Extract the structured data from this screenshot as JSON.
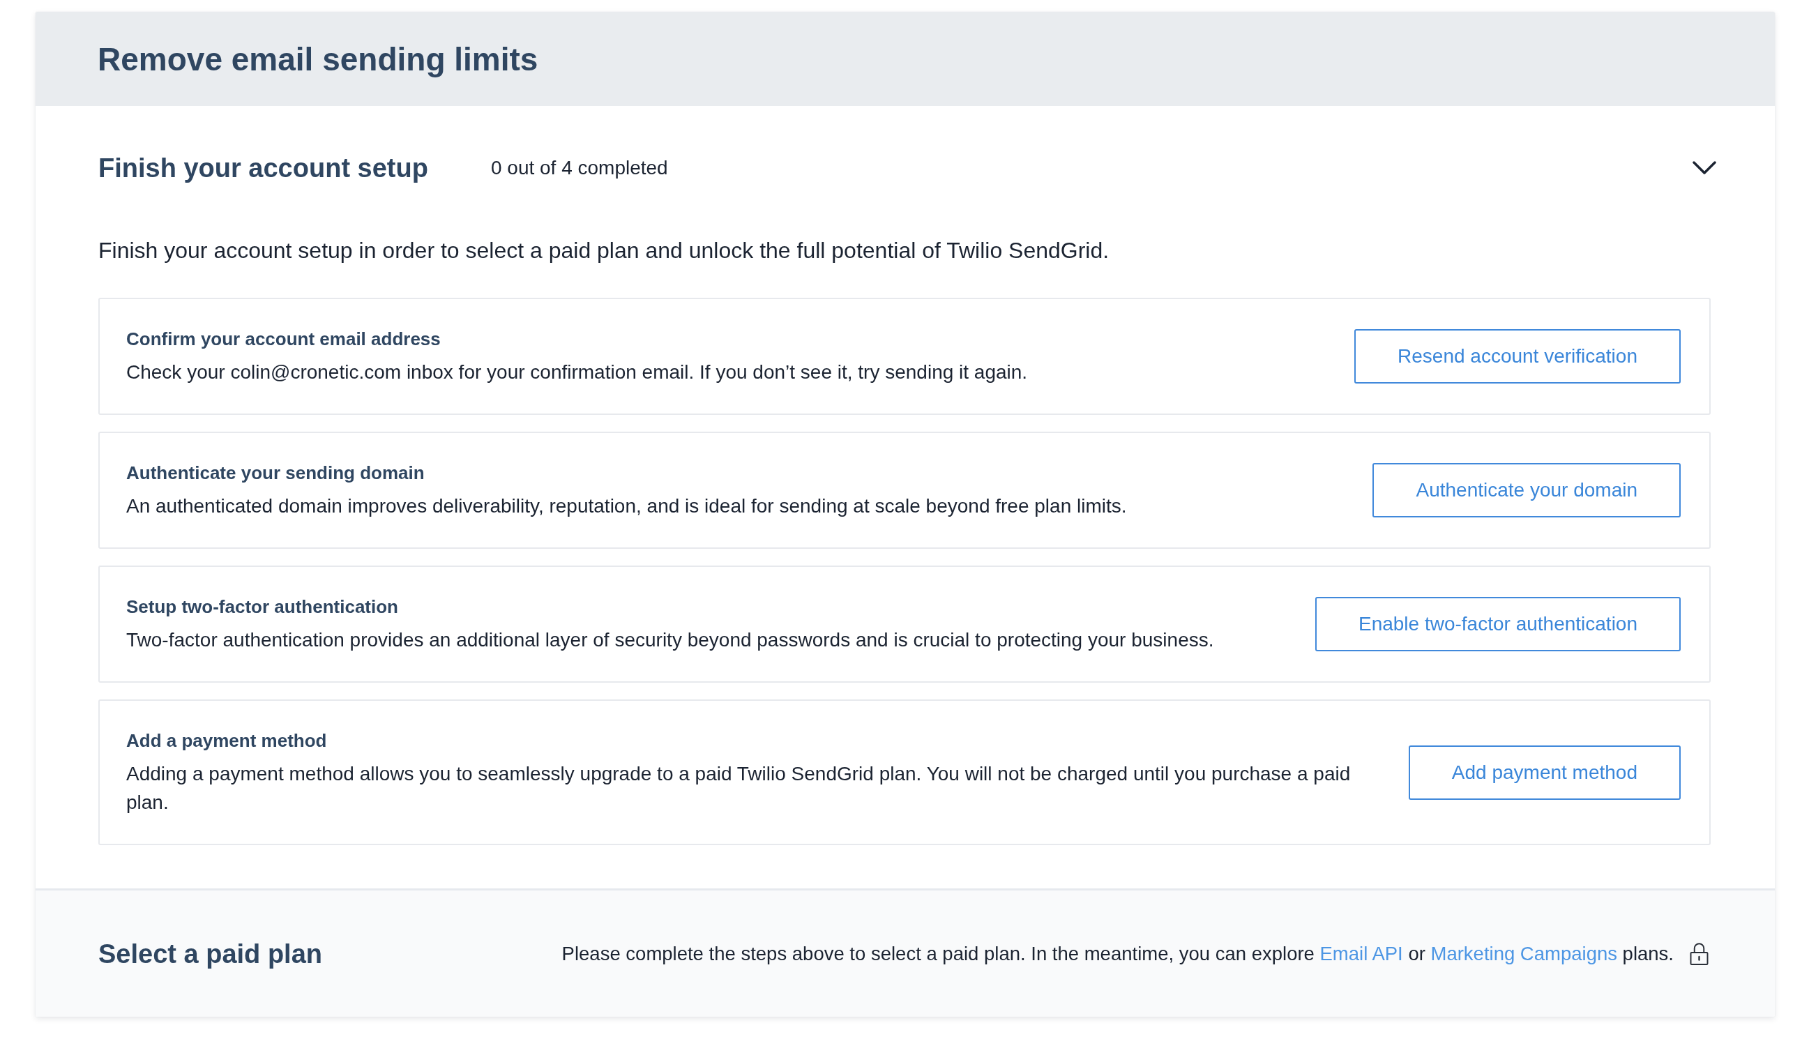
{
  "banner": {
    "title": "Remove email sending limits"
  },
  "setup": {
    "title": "Finish your account setup",
    "progress": "0 out of 4 completed",
    "expanded": true,
    "description": "Finish your account setup in order to select a paid plan and unlock the full potential of Twilio SendGrid.",
    "steps": [
      {
        "title": "Confirm your account email address",
        "description": "Check your colin@cronetic.com inbox for your confirmation email. If you don’t see it, try sending it again.",
        "button": "Resend account verification"
      },
      {
        "title": "Authenticate your sending domain",
        "description": "An authenticated domain improves deliverability, reputation, and is ideal for sending at scale beyond free plan limits.",
        "button": "Authenticate your domain"
      },
      {
        "title": "Setup two-factor authentication",
        "description": "Two-factor authentication provides an additional layer of security beyond passwords and is crucial to protecting your business.",
        "button": "Enable two-factor authentication"
      },
      {
        "title": "Add a payment method",
        "description": "Adding a payment method allows you to seamlessly upgrade to a paid Twilio SendGrid plan. You will not be charged until you purchase a paid plan.",
        "button": "Add payment method"
      }
    ]
  },
  "plan": {
    "title": "Select a paid plan",
    "locked": true,
    "message": [
      {
        "kind": "text",
        "text": "Please complete the steps above to select a paid plan. In the meantime, you can explore "
      },
      {
        "kind": "link",
        "text": "Email API"
      },
      {
        "kind": "text",
        "text": " or "
      },
      {
        "kind": "link",
        "text": "Marketing Campaigns"
      },
      {
        "kind": "text",
        "text": " plans."
      }
    ]
  }
}
